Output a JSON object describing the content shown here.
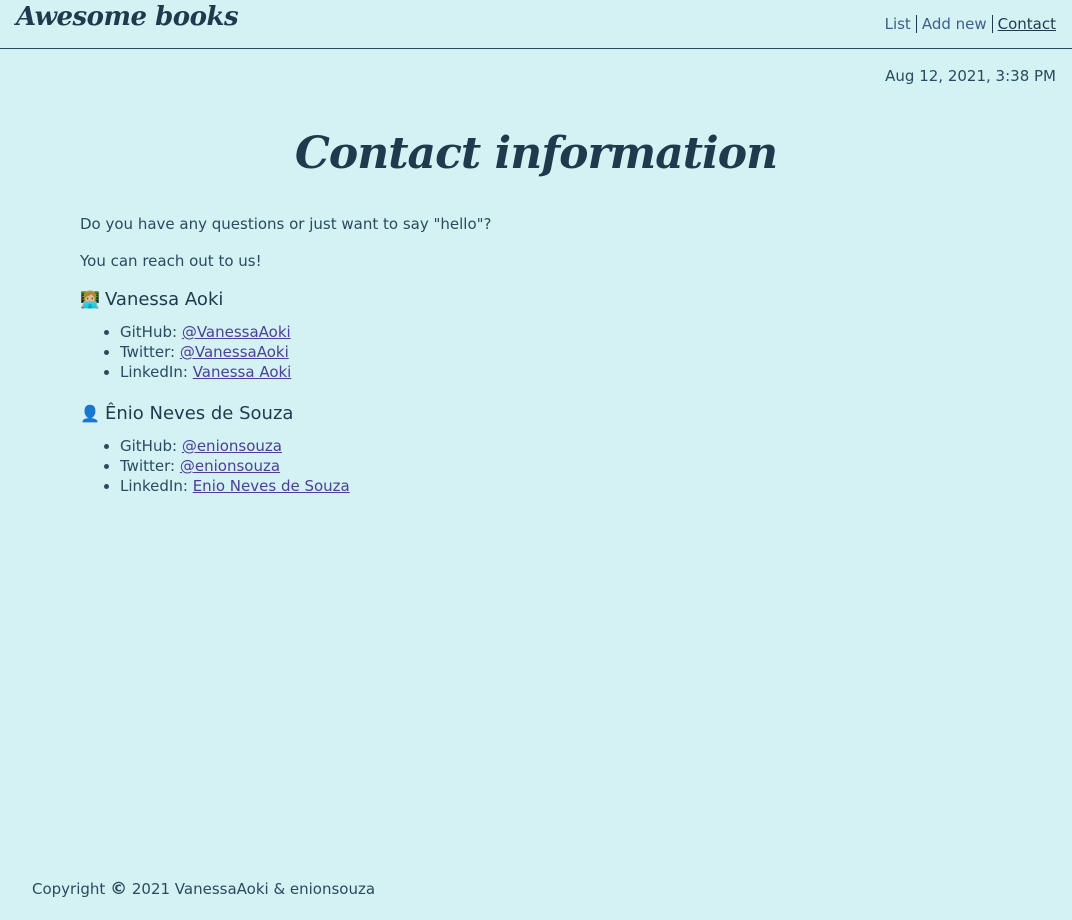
{
  "header": {
    "logo": "Awesome books",
    "nav": [
      {
        "label": "List"
      },
      {
        "label": "Add new"
      },
      {
        "label": "Contact"
      }
    ]
  },
  "date": "Aug 12, 2021, 3:38 PM",
  "page": {
    "title": "Contact information",
    "intro": "Do you have any questions or just want to say \"hello\"?",
    "reach": "You can reach out to us!"
  },
  "people": [
    {
      "emoji": "👩🏼‍💻",
      "name": "Vanessa Aoki",
      "links": [
        {
          "label": "GitHub:",
          "value": "@VanessaAoki"
        },
        {
          "label": "Twitter:",
          "value": "@VanessaAoki"
        },
        {
          "label": "LinkedIn:",
          "value": "Vanessa Aoki"
        }
      ]
    },
    {
      "emoji": "👤",
      "name": "Ênio Neves de Souza",
      "links": [
        {
          "label": "GitHub:",
          "value": "@enionsouza"
        },
        {
          "label": "Twitter:",
          "value": "@enionsouza"
        },
        {
          "label": "LinkedIn:",
          "value": "Enio Neves de Souza"
        }
      ]
    }
  ],
  "footer": {
    "prefix": "Copyright",
    "symbol": "©",
    "text": "2021 VanessaAoki & enionsouza"
  }
}
